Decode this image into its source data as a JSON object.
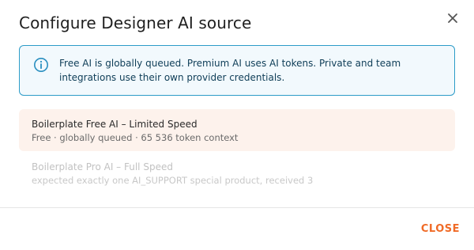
{
  "dialog": {
    "title": "Configure Designer AI source",
    "close_icon": "close-icon"
  },
  "info": {
    "icon": "info-icon",
    "text": "Free AI is globally queued. Premium AI uses AI tokens. Private and team integrations use their own provider credentials.",
    "accent_color": "#2d9cc8"
  },
  "options": [
    {
      "title": "Boilerplate Free AI – Limited Speed",
      "subtitle": "Free · globally queued · 65 536 token context",
      "state": "selected"
    },
    {
      "title": "Boilerplate Pro AI – Full Speed",
      "subtitle": "expected exactly one AI_SUPPORT special product, received 3",
      "state": "disabled"
    }
  ],
  "footer": {
    "close_label": "CLOSE",
    "accent_color": "#f06b27"
  }
}
